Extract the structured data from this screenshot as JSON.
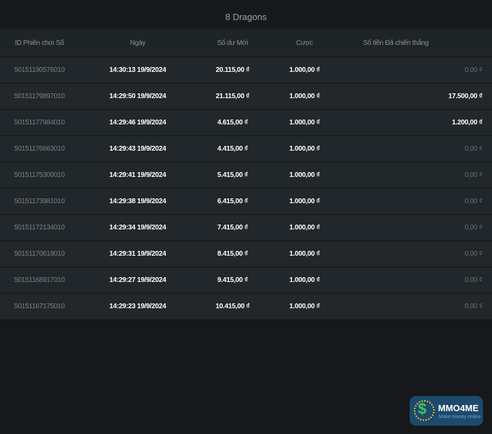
{
  "title": "8 Dragons",
  "columns": [
    "ID Phiên chơi Số",
    "Ngày",
    "Số dư Mới",
    "Cược",
    "Số tiền Đã chiến thắng"
  ],
  "rows": [
    [
      "50151190576010",
      "14:30:13 19/9/2024",
      "20.115,00 ₫",
      "1.000,00 ₫",
      "0,00 ₫"
    ],
    [
      "50151179897010",
      "14:29:50 19/9/2024",
      "21.115,00 ₫",
      "1.000,00 ₫",
      "17.500,00 ₫"
    ],
    [
      "50151177984010",
      "14:29:46 19/9/2024",
      "4.615,00 ₫",
      "1.000,00 ₫",
      "1.200,00 ₫"
    ],
    [
      "50151176663010",
      "14:29:43 19/9/2024",
      "4.415,00 ₫",
      "1.000,00 ₫",
      "0,00 ₫"
    ],
    [
      "50151175300010",
      "14:29:41 19/9/2024",
      "5.415,00 ₫",
      "1.000,00 ₫",
      "0,00 ₫"
    ],
    [
      "50151173981010",
      "14:29:38 19/9/2024",
      "6.415,00 ₫",
      "1.000,00 ₫",
      "0,00 ₫"
    ],
    [
      "50151172134010",
      "14:29:34 19/9/2024",
      "7.415,00 ₫",
      "1.000,00 ₫",
      "0,00 ₫"
    ],
    [
      "50151170619010",
      "14:29:31 19/9/2024",
      "8.415,00 ₫",
      "1.000,00 ₫",
      "0,00 ₫"
    ],
    [
      "50151168917010",
      "14:29:27 19/9/2024",
      "9.415,00 ₫",
      "1.000,00 ₫",
      "0,00 ₫"
    ],
    [
      "50151167175010",
      "14:29:23 19/9/2024",
      "10.415,00 ₫",
      "1.000,00 ₫",
      "0,00 ₫"
    ]
  ],
  "watermark": {
    "name": "MMO4ME",
    "tagline": "Make money online",
    "symbol": "$"
  }
}
